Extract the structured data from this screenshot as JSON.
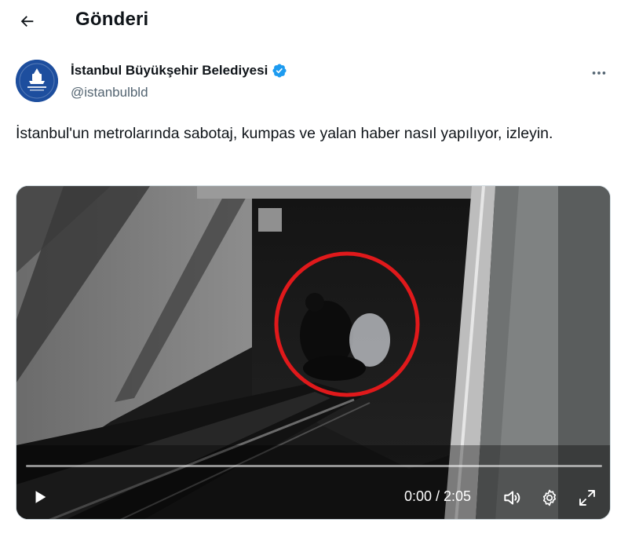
{
  "header": {
    "title": "Gönderi",
    "back_icon": "arrow-left-icon"
  },
  "author": {
    "name": "İstanbul Büyükşehir Belediyesi",
    "handle": "@istanbulbld",
    "verified": true,
    "verified_color": "#1d9bf0",
    "avatar_bg": "#1d4e9e",
    "avatar_icon": "ibb-logo-icon",
    "more_icon": "more-horizontal-icon"
  },
  "tweet": {
    "text": "İstanbul'un metrolarında sabotaj, kumpas ve yalan haber nasıl yapılıyor, izleyin."
  },
  "video": {
    "current_time": "0:00",
    "duration": "2:05",
    "time_label": "0:00 / 2:05",
    "progress": 0,
    "highlight_circle_color": "#e0191b",
    "play_icon": "play-icon",
    "volume_icon": "volume-icon",
    "settings_icon": "gear-icon",
    "fullscreen_icon": "fullscreen-icon"
  }
}
